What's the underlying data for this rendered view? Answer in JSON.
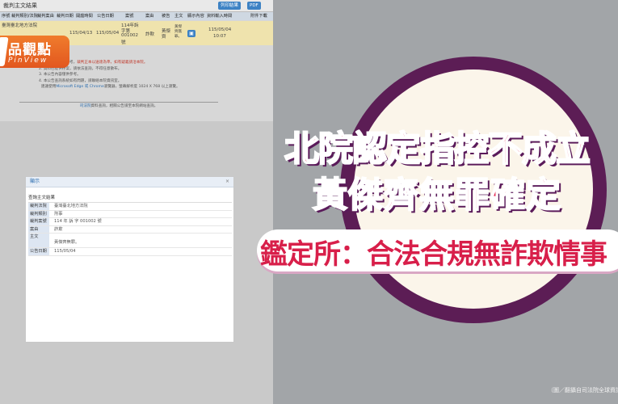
{
  "window": {
    "title": "裁判主文結果",
    "print_label": "列印結果",
    "pdf_label": "PDF"
  },
  "table": {
    "headers": [
      "序號",
      "裁判類別/法院",
      "裁判案由",
      "裁判日期",
      "開庭時間",
      "公告日期",
      "案號",
      "案由",
      "被告",
      "主文",
      "顯示內容",
      "資料輸入時間",
      "附件下載"
    ],
    "row": {
      "case_label": "臺灣臺北地方法院",
      "hearing_date": "115/04/13",
      "announce_date": "115/05/04",
      "case_no_l1": "114年訴",
      "case_no_l2": "字第",
      "case_no_l3": "001002",
      "case_no_l4": "號",
      "cause": "詐欺",
      "defendant_l1": "黃傑",
      "defendant_l2": "齊",
      "verdict_l1": "黃傑",
      "verdict_l2": "齊無",
      "verdict_l3": "罪。",
      "entry_date": "115/05/04",
      "entry_time": "10:07"
    }
  },
  "notes": {
    "note1_prefix": "1. 本院資料僅供參考，",
    "note1_red": "裁判正本以送達為準，如有疑義請洽本院。",
    "note2": "2. 資料已提供存案，請依法查詢，不得任意散布。",
    "note3": "3. 本公告內容僅供參考。",
    "note4": "4. 本公告查詢系統如有問題，請聯絡本院資訊室。",
    "note4b_prefix": "建議使用",
    "note4b_blue": "Microsoft Edge 或 Chrome",
    "note4b_suffix": "瀏覽器，螢幕解析度 1024 X 768 以上瀏覽。",
    "footer_blue": "司法院",
    "footer_text": "資料查詢，相關公告請至本院網站查詢。"
  },
  "brand": {
    "name": "品觀點",
    "sub": "PinView"
  },
  "dialog": {
    "title": "顯示",
    "close_icon": "close-icon",
    "section": "查詢主文結果",
    "fields": [
      {
        "label": "裁判法院",
        "value": "臺灣臺北地方法院"
      },
      {
        "label": "裁判類別",
        "value": "刑事"
      },
      {
        "label": "裁判案號",
        "value": "114 年 訴 字 001002 號"
      },
      {
        "label": "案由",
        "value": "詐欺"
      },
      {
        "label": "主文",
        "value": "黃傑齊無罪。"
      },
      {
        "label": "公告日期",
        "value": "115/05/04"
      }
    ]
  },
  "headline": {
    "line1": "北院認定指控不成立",
    "line2": "黃傑齊無罪確定",
    "line3": "鑑定所：合法合規無詐欺情事"
  },
  "credit": "（圖／翻攝自司法院全球資訊網）",
  "colors": {
    "headline_red": "#e4234e",
    "ring_purple": "#5c1d55",
    "brand_orange": "#f07c2c",
    "row_highlight": "#efe3ad",
    "link_blue": "#2e6fb0"
  }
}
